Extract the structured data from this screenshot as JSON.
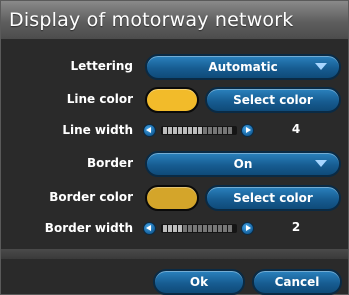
{
  "dialog": {
    "title": "Display of motorway network"
  },
  "rows": {
    "lettering": {
      "label": "Lettering",
      "value": "Automatic"
    },
    "line_color": {
      "label": "Line color",
      "swatch_color": "#f2bb2a",
      "button": "Select color"
    },
    "line_width": {
      "label": "Line width",
      "value": "4",
      "level": 0.6
    },
    "border": {
      "label": "Border",
      "value": "On"
    },
    "border_color": {
      "label": "Border color",
      "swatch_color": "#d4a52a",
      "button": "Select color"
    },
    "border_width": {
      "label": "Border width",
      "value": "2",
      "level": 0.3
    }
  },
  "footer": {
    "ok": "Ok",
    "cancel": "Cancel"
  },
  "colors": {
    "accent": "#1f6ea8",
    "background": "#2a2a2a"
  }
}
